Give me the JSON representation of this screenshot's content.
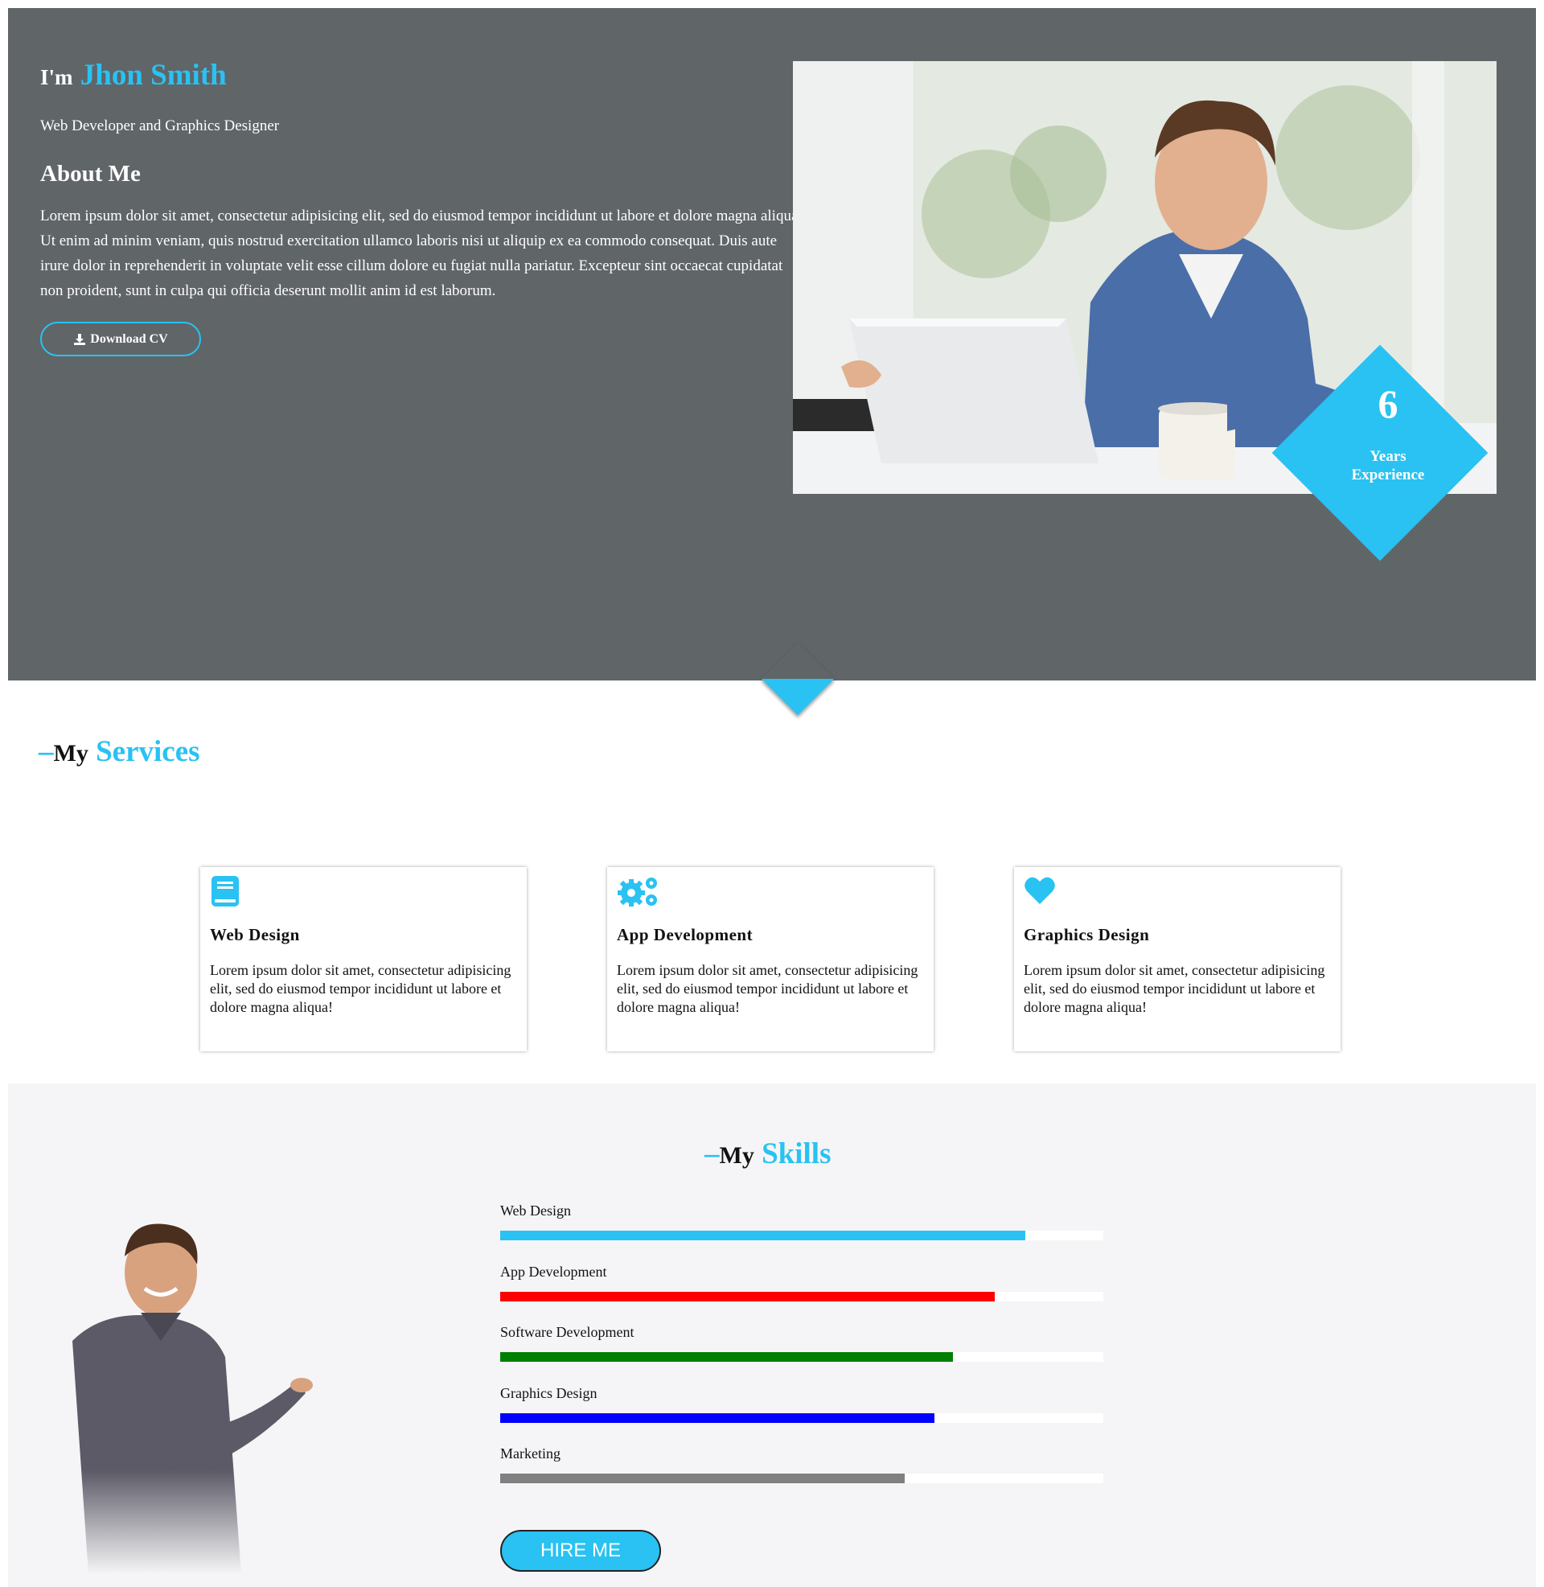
{
  "hero": {
    "greeting": "I'm",
    "name": "Jhon Smith",
    "subtitle": "Web Developer and Graphics Designer",
    "about_heading": "About Me",
    "about_text": "Lorem ipsum dolor sit amet, consectetur adipisicing elit, sed do eiusmod tempor incididunt ut labore et dolore magna aliqua. Ut enim ad minim veniam, quis nostrud exercitation ullamco laboris nisi ut aliquip ex ea commodo consequat. Duis aute irure dolor in reprehenderit in voluptate velit esse cillum dolore eu fugiat nulla pariatur. Excepteur sint occaecat cupidatat non proident, sunt in culpa qui officia deserunt mollit anim id est laborum.",
    "cv_button_label": "Download CV",
    "cv_button_icon": "download-icon",
    "experience_number": "6",
    "experience_label_line1": "Years",
    "experience_label_line2": "Experience",
    "background_color": "#606568",
    "accent_color": "#29c2f2"
  },
  "services": {
    "heading_dash": "–",
    "heading_word1": "My",
    "heading_word2": "Services",
    "cards": [
      {
        "icon": "book-icon",
        "title": "Web Design",
        "text": "Lorem ipsum dolor sit amet, consectetur adipisicing elit, sed do eiusmod tempor incididunt ut labore et dolore magna aliqua!"
      },
      {
        "icon": "gears-icon",
        "title": "App Development",
        "text": "Lorem ipsum dolor sit amet, consectetur adipisicing elit, sed do eiusmod tempor incididunt ut labore et dolore magna aliqua!"
      },
      {
        "icon": "heart-icon",
        "title": "Graphics Design",
        "text": "Lorem ipsum dolor sit amet, consectetur adipisicing elit, sed do eiusmod tempor incididunt ut labore et dolore magna aliqua!"
      }
    ]
  },
  "skills": {
    "heading_dash": "–",
    "heading_word1": "My",
    "heading_word2": "Skills",
    "items": [
      {
        "label": "Web Design",
        "percent": 87,
        "color": "#29c2f2"
      },
      {
        "label": "App Development",
        "percent": 82,
        "color": "#ff0000"
      },
      {
        "label": "Software Development",
        "percent": 75,
        "color": "#008000"
      },
      {
        "label": "Graphics Design",
        "percent": 72,
        "color": "#0000ff"
      },
      {
        "label": "Marketing",
        "percent": 67,
        "color": "#808080"
      }
    ],
    "hire_button_label": "HIRE ME"
  }
}
